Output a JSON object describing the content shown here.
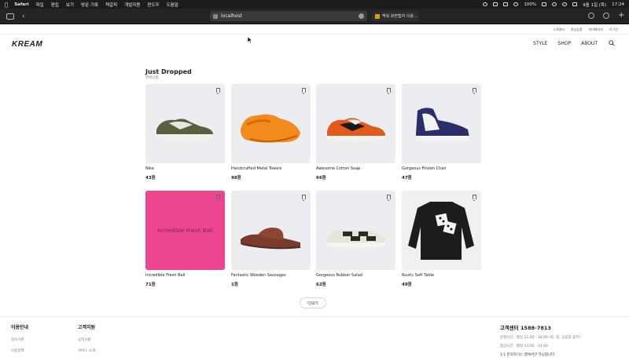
{
  "menubar": {
    "app": "Safari",
    "items": [
      "파일",
      "편집",
      "보기",
      "방문 기록",
      "책갈피",
      "개발자용",
      "윈도우",
      "도움말"
    ],
    "battery": "100%",
    "date": "9월 1일 (목)",
    "time": "17:24"
  },
  "browser": {
    "url": "localhost",
    "second_tab": "맥북 화면캡처 이용…"
  },
  "site": {
    "logo": "KREAM",
    "top_links": [
      "고객센터",
      "관심상품",
      "마이페이지",
      "로그인"
    ],
    "nav": [
      "STYLE",
      "SHOP",
      "ABOUT"
    ],
    "section": {
      "title": "Just Dropped",
      "subtitle": "발매상품"
    },
    "products": [
      {
        "name": "Nike",
        "price": "43원"
      },
      {
        "name": "Handcrafted Metal Towels",
        "price": "98원"
      },
      {
        "name": "Awesome Cotton Soap",
        "price": "66원"
      },
      {
        "name": "Gorgeous Frozen Chair",
        "price": "47원"
      },
      {
        "name": "Incredible Fresh Ball",
        "price": "71원",
        "placeholder": "Incredible Fresh Ball"
      },
      {
        "name": "Fantastic Wooden Sausages",
        "price": "1원"
      },
      {
        "name": "Gorgeous Rubber Salad",
        "price": "62원"
      },
      {
        "name": "Rustic Soft Table",
        "price": "49원"
      }
    ],
    "more_button": "더보기"
  },
  "footer": {
    "col1": {
      "title": "이용안내",
      "items": [
        "검수기준",
        "이용정책"
      ]
    },
    "col2": {
      "title": "고객지원",
      "items": [
        "공지사항",
        "서비스 소개"
      ]
    },
    "cs": {
      "title": "고객센터 1588-7813",
      "hours": "운영시간 : 평일 11:00 - 18:00 (토, 일, 공휴일 휴무)",
      "lunch": "점심시간 : 평일 13:00 - 14:00",
      "note": "1:1 문의하기는 앱에서만 가능합니다."
    }
  },
  "colors": {
    "pink_card": "#ec4690",
    "thumb_bg": "#ebedf0"
  }
}
